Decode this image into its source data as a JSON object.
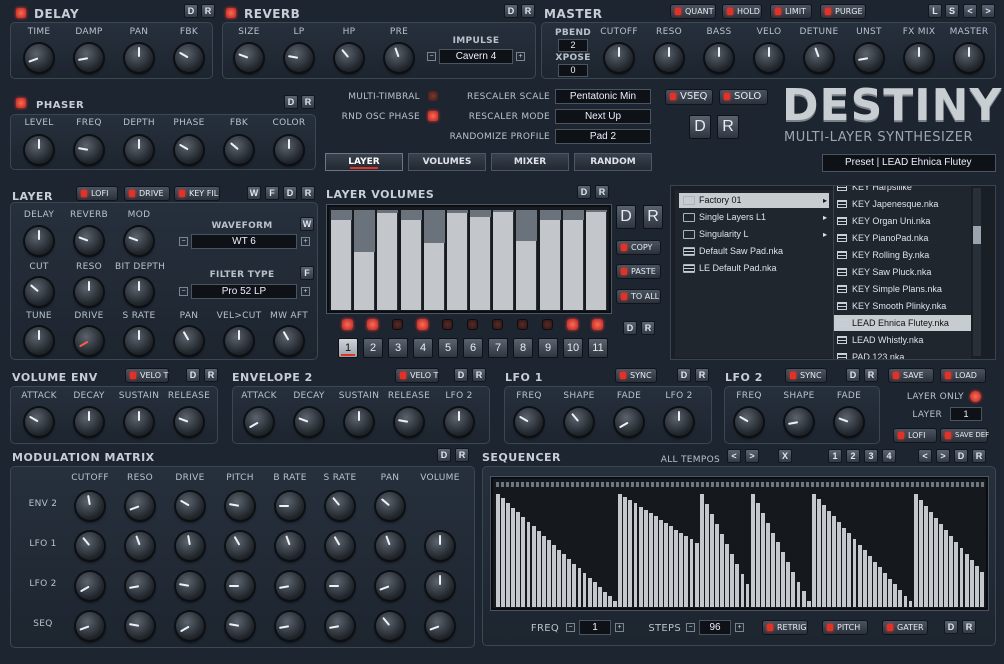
{
  "delay": {
    "title": "DELAY",
    "d": "D",
    "r": "R",
    "knobs": [
      "TIME",
      "DAMP",
      "PAN",
      "FBK"
    ]
  },
  "reverb": {
    "title": "REVERB",
    "d": "D",
    "r": "R",
    "knobs": [
      "SIZE",
      "LP",
      "HP",
      "PRE"
    ],
    "impulse_label": "IMPULSE",
    "impulse_value": "Cavern 4"
  },
  "master": {
    "title": "MASTER",
    "buttons": [
      "QUANT",
      "HOLD",
      "LIMIT",
      "PURGE"
    ],
    "nav": [
      "L",
      "S",
      "<",
      ">"
    ],
    "pbend_label": "PBEND",
    "pbend_value": "2",
    "xpose_label": "XPOSE",
    "xpose_value": "0",
    "knobs": [
      "CUTOFF",
      "RESO",
      "BASS",
      "VELO",
      "DETUNE",
      "UNST",
      "FX MIX",
      "MASTER"
    ]
  },
  "phaser": {
    "title": "PHASER",
    "d": "D",
    "r": "R",
    "knobs": [
      "LEVEL",
      "FREQ",
      "DEPTH",
      "PHASE",
      "FBK",
      "COLOR"
    ]
  },
  "global": {
    "multi_timbral": "MULTI-TIMBRAL",
    "rnd_osc_phase": "RND OSC PHASE",
    "rescaler_scale": "RESCALER SCALE",
    "rescaler_scale_value": "Pentatonic Min",
    "rescaler_mode": "RESCALER MODE",
    "rescaler_mode_value": "Next Up",
    "randomize_profile": "RANDOMIZE PROFILE",
    "randomize_profile_value": "Pad 2",
    "vseq": "VSEQ",
    "solo": "SOLO",
    "d": "D",
    "r": "R"
  },
  "tabs": [
    "LAYER",
    "VOLUMES",
    "MIXER",
    "RANDOM"
  ],
  "brand": {
    "title": "DESTINY",
    "subtitle": "MULTI-LAYER SYNTHESIZER",
    "preset": "Preset | LEAD Ehnica Flutey"
  },
  "layer": {
    "title": "LAYER",
    "lofi": "LOFI",
    "drive": "DRIVE",
    "keyfil": "KEY FIL",
    "w": "W",
    "f": "F",
    "d": "D",
    "r": "R",
    "knobs_row1": [
      "DELAY",
      "REVERB",
      "MOD"
    ],
    "knobs_row2": [
      "CUT",
      "RESO",
      "BIT DEPTH"
    ],
    "knobs_row3": [
      "TUNE",
      "DRIVE",
      "S RATE",
      "PAN",
      "VEL>CUT",
      "MW AFT"
    ],
    "waveform_label": "WAVEFORM",
    "waveform_value": "WT 6",
    "filter_label": "FILTER TYPE",
    "filter_value": "Pro 52 LP"
  },
  "layer_volumes": {
    "title": "LAYER VOLUMES",
    "d": "D",
    "r": "R",
    "copy": "COPY",
    "paste": "PASTE",
    "to_all": "TO ALL",
    "numbers": [
      "1",
      "2",
      "3",
      "4",
      "5",
      "6",
      "7",
      "8",
      "9",
      "10",
      "11"
    ],
    "levels": [
      0.9,
      0.58,
      0.97,
      0.9,
      0.67,
      0.97,
      0.93,
      0.98,
      0.69,
      0.9,
      0.9,
      0.98
    ]
  },
  "browser": {
    "folders": [
      "Factory 01",
      "Single Layers L1",
      "Singularity L",
      "Default Saw Pad.nka",
      "LE Default Pad.nka"
    ],
    "presets": [
      "KEY Harpsilike",
      "KEY Japenesque.nka",
      "KEY Organ Uni.nka",
      "KEY PianoPad.nka",
      "KEY Rolling By.nka",
      "KEY Saw Pluck.nka",
      "KEY Simple Plans.nka",
      "KEY Smooth Plinky.nka",
      "LEAD Ehnica Flutey.nka",
      "LEAD Whistly.nka",
      "PAD 123.nka"
    ],
    "selected": 8
  },
  "volume_env": {
    "title": "VOLUME ENV",
    "velo_t": "VELO T",
    "d": "D",
    "r": "R",
    "knobs": [
      "ATTACK",
      "DECAY",
      "SUSTAIN",
      "RELEASE"
    ]
  },
  "envelope2": {
    "title": "ENVELOPE 2",
    "velo_t": "VELO T",
    "d": "D",
    "r": "R",
    "knobs": [
      "ATTACK",
      "DECAY",
      "SUSTAIN",
      "RELEASE",
      "LFO 2"
    ]
  },
  "lfo1": {
    "title": "LFO 1",
    "sync": "SYNC",
    "d": "D",
    "r": "R",
    "knobs": [
      "FREQ",
      "SHAPE",
      "FADE",
      "LFO 2"
    ]
  },
  "lfo2": {
    "title": "LFO 2",
    "sync": "SYNC",
    "d": "D",
    "r": "R",
    "knobs": [
      "FREQ",
      "SHAPE",
      "FADE"
    ]
  },
  "side": {
    "save": "SAVE",
    "load": "LOAD",
    "layer_only": "LAYER ONLY",
    "layer_label": "LAYER",
    "layer_value": "1",
    "lofi": "LOFI",
    "save_def": "SAVE DEF"
  },
  "modmatrix": {
    "title": "MODULATION MATRIX",
    "d": "D",
    "r": "R",
    "cols": [
      "CUTOFF",
      "RESO",
      "DRIVE",
      "PITCH",
      "B RATE",
      "S RATE",
      "PAN",
      "VOLUME"
    ],
    "rows": [
      "ENV 2",
      "LFO 1",
      "LFO 2",
      "SEQ"
    ]
  },
  "sequencer": {
    "title": "SEQUENCER",
    "all_tempos": "ALL TEMPOS",
    "x": "X",
    "pages": [
      "1",
      "2",
      "3",
      "4"
    ],
    "d": "D",
    "r": "R",
    "freq_label": "FREQ",
    "freq_value": "1",
    "steps_label": "STEPS",
    "steps_value": "96",
    "retrig": "RETRIG",
    "pitch": "PITCH",
    "gater": "GATER"
  }
}
